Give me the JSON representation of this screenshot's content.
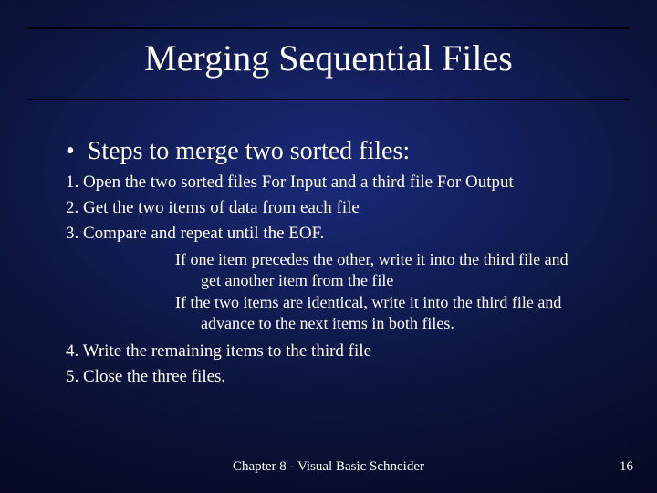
{
  "title": "Merging Sequential Files",
  "bullet": {
    "text": "Steps to merge two sorted files:"
  },
  "steps": {
    "s1": "1. Open the two sorted files For Input and a third file For Output",
    "s2": "2. Get the two items of data from each file",
    "s3": "3. Compare and repeat until the EOF.",
    "sub1a": "If one item precedes the other, write it into the third file and",
    "sub1b": "get another item from the file",
    "sub2a": "If the two items are identical, write it into the third file and",
    "sub2b": "advance to the next items in both files.",
    "s4": "4. Write the remaining items to the third file",
    "s5": "5. Close the three files."
  },
  "footer": {
    "left": "Chapter 8 - Visual Basic    Schneider",
    "page": "16"
  }
}
